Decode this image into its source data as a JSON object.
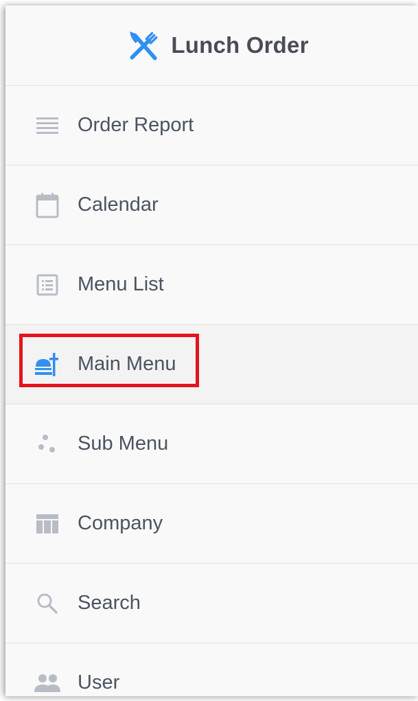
{
  "app": {
    "title": "Lunch Order",
    "logo_icon": "fork-knife-icon",
    "accent_color": "#2f8ff3"
  },
  "nav": {
    "items": [
      {
        "label": "Order Report",
        "icon": "list-lines-icon"
      },
      {
        "label": "Calendar",
        "icon": "calendar-icon"
      },
      {
        "label": "Menu List",
        "icon": "list-box-icon"
      },
      {
        "label": "Main Menu",
        "icon": "food-tray-icon",
        "active": true,
        "highlighted": true
      },
      {
        "label": "Sub Menu",
        "icon": "dots-icon"
      },
      {
        "label": "Company",
        "icon": "table-grid-icon"
      },
      {
        "label": "Search",
        "icon": "search-icon"
      },
      {
        "label": "User",
        "icon": "users-icon"
      }
    ]
  },
  "colors": {
    "sidebar_bg": "#f9f9f9",
    "text": "#4b5361",
    "icon_muted": "#b8bcc6",
    "highlight_border": "#e3141b"
  }
}
